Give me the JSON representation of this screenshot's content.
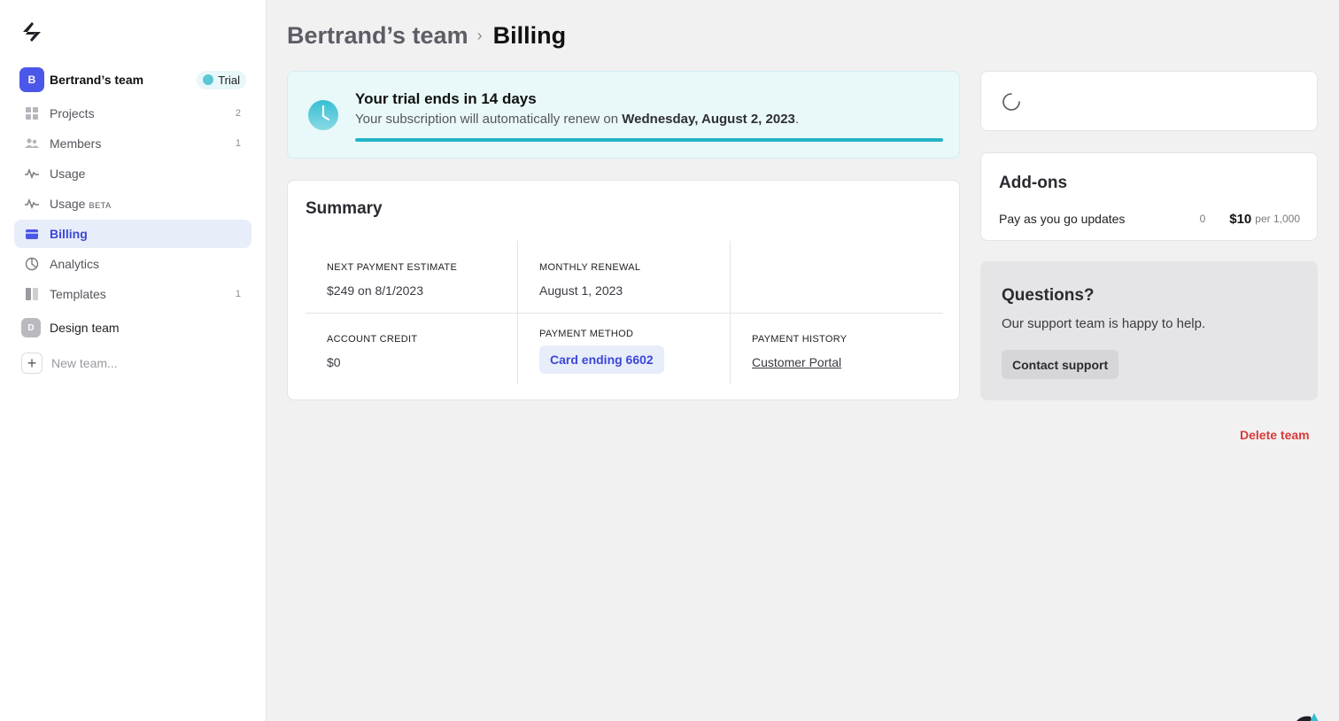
{
  "sidebar": {
    "team": {
      "initial": "B",
      "name": "Bertrand’s team",
      "badge": "Trial"
    },
    "items": [
      {
        "label": "Projects",
        "count": "2",
        "icon": "grid-icon"
      },
      {
        "label": "Members",
        "count": "1",
        "icon": "users-icon"
      },
      {
        "label": "Usage",
        "count": "",
        "icon": "activity-icon"
      },
      {
        "label": "Usage",
        "beta": "BETA",
        "count": "",
        "icon": "activity-icon"
      },
      {
        "label": "Billing",
        "count": "",
        "icon": "credit-card-icon",
        "active": true
      },
      {
        "label": "Analytics",
        "count": "",
        "icon": "pie-chart-icon"
      },
      {
        "label": "Templates",
        "count": "1",
        "icon": "template-icon"
      }
    ],
    "other_team": {
      "initial": "D",
      "name": "Design team"
    },
    "new_team": "New team..."
  },
  "breadcrumb": {
    "parent": "Bertrand’s team",
    "current": "Billing"
  },
  "trial": {
    "title": "Your trial ends in 14 days",
    "sub_prefix": "Your subscription will automatically renew on",
    "renew_date": "Wednesday, August 2, 2023",
    "sub_suffix": ".",
    "progress_fraction": 1.0
  },
  "summary": {
    "title": "Summary",
    "next_payment_label": "NEXT PAYMENT ESTIMATE",
    "next_payment_value": "$249 on 8/1/2023",
    "monthly_renewal_label": "MONTHLY RENEWAL",
    "monthly_renewal_value": "August 1, 2023",
    "account_credit_label": "ACCOUNT CREDIT",
    "account_credit_value": "$0",
    "payment_method_label": "PAYMENT METHOD",
    "payment_method_value": "Card ending 6602",
    "payment_history_label": "PAYMENT HISTORY",
    "payment_history_link": "Customer Portal"
  },
  "addons": {
    "title": "Add-ons",
    "rows": [
      {
        "name": "Pay as you go updates",
        "qty": "0",
        "price": "$10",
        "per": "per 1,000"
      }
    ]
  },
  "questions": {
    "title": "Questions?",
    "text": "Our support team is happy to help.",
    "button": "Contact support"
  },
  "delete_team": "Delete team",
  "colors": {
    "accent": "#4b57e8",
    "trial_bar": "#23b3c7",
    "danger": "#d93a3a"
  }
}
